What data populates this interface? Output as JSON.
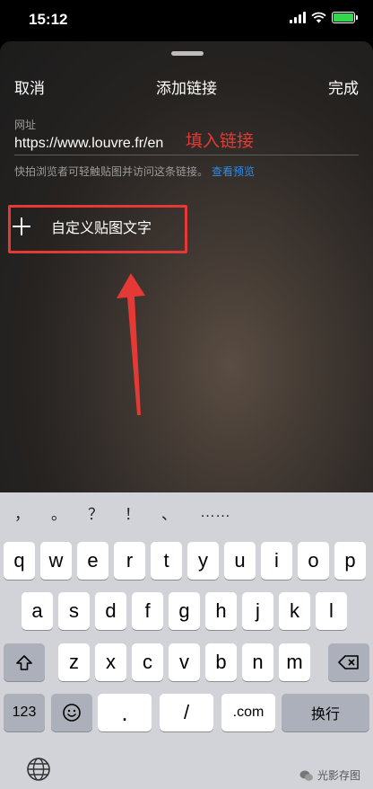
{
  "status_bar": {
    "time": "15:12",
    "battery_color": "#32d74b"
  },
  "header": {
    "cancel_label": "取消",
    "title": "添加链接",
    "done_label": "完成"
  },
  "url_field": {
    "label": "网址",
    "value": "https://www.louvre.fr/en",
    "note": "快拍浏览者可轻触贴图并访问这条链接。",
    "preview_link": "查看预览"
  },
  "annotation": {
    "text": "填入链接",
    "color": "#e53935"
  },
  "custom_text_row": {
    "icon": "plus-icon",
    "label": "自定义贴图文字"
  },
  "keyboard": {
    "suggestions": [
      "，",
      "。",
      "？",
      "！",
      "、",
      "……"
    ],
    "row1": [
      "q",
      "w",
      "e",
      "r",
      "t",
      "y",
      "u",
      "i",
      "o",
      "p"
    ],
    "row2": [
      "a",
      "s",
      "d",
      "f",
      "g",
      "h",
      "j",
      "k",
      "l"
    ],
    "row3": [
      "z",
      "x",
      "c",
      "v",
      "b",
      "n",
      "m"
    ],
    "shift_icon": "shift-icon",
    "backspace_icon": "backspace-icon",
    "numbers_label": "123",
    "emoji_icon": "emoji-icon",
    "dot_label": ".",
    "slash_label": "/",
    "com_label": ".com",
    "return_label": "换行",
    "globe_icon": "globe-icon"
  },
  "watermark": {
    "text": "光影存图"
  }
}
